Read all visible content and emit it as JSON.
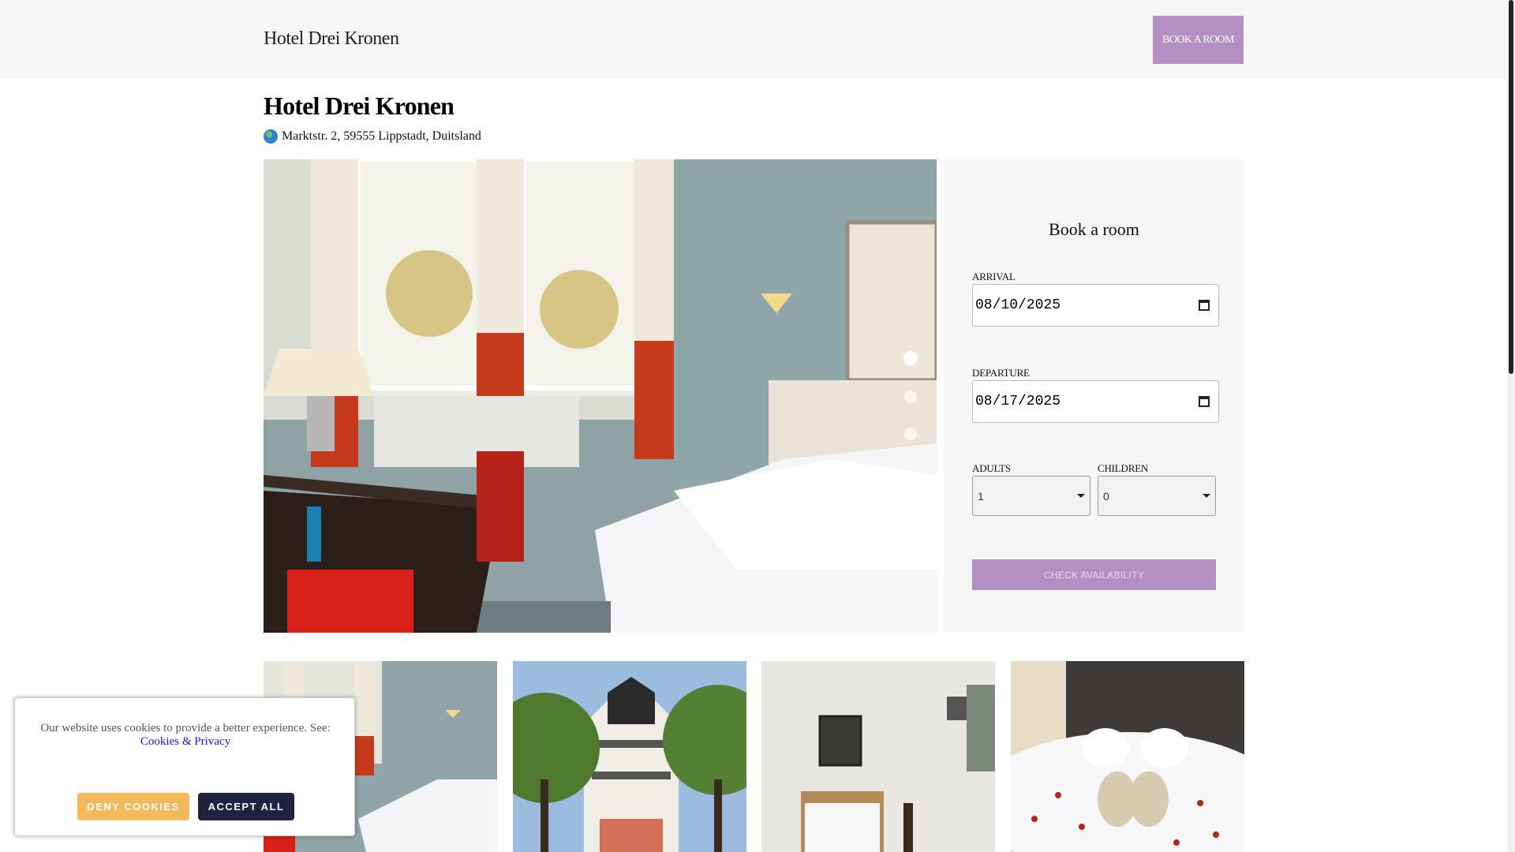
{
  "header": {
    "brand": "Hotel Drei Kronen",
    "book_button": "BOOK A ROOM"
  },
  "hotel": {
    "name": "Hotel Drei Kronen",
    "address": "Marktstr. 2, 59555 Lippstadt, Duitsland",
    "address_icon": "globe-icon"
  },
  "gallery": {
    "hero_image": "hotel room with double bed, desk and windows",
    "slide_count": 3,
    "active_slide": 1,
    "thumbnails": [
      "hotel room with bed and desk",
      "hotel building exterior with trees",
      "single room with bed",
      "bed with towel swans and rose petals"
    ]
  },
  "booking": {
    "title": "Book a room",
    "arrival_label": "ARRIVAL",
    "arrival_value": "08/10/2025",
    "departure_label": "DEPARTURE",
    "departure_value": "08/17/2025",
    "adults_label": "ADULTS",
    "adults_value": "1",
    "children_label": "CHILDREN",
    "children_value": "0",
    "check_button": "CHECK AVAILABILITY"
  },
  "cookie": {
    "text": "Our website uses cookies to provide a better experience. See:",
    "link": "Cookies & Privacy",
    "deny": "DENY COOKIES",
    "accept": "ACCEPT ALL"
  },
  "colors": {
    "accent": "#b48fc3",
    "deny": "#f3b95a",
    "accept": "#1e2341"
  }
}
